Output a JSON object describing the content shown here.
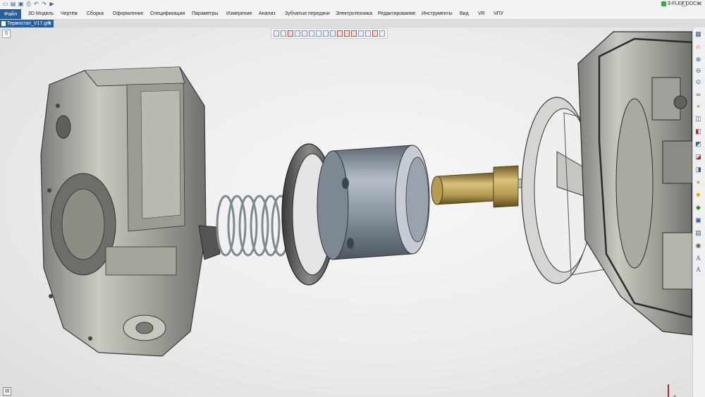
{
  "app": {
    "brand": "T-FLEX DOCs",
    "window_controls": [
      "–",
      "▢",
      "✕"
    ]
  },
  "menu": {
    "file": "Файл",
    "items": [
      "3D Модель",
      "Чертёж",
      "Сборка",
      "Оформление",
      "Спецификации",
      "Параметры",
      "Измерение",
      "Анализ",
      "Зубчатые передачи",
      "Электротехника",
      "Редактирование",
      "Инструменты",
      "Вид",
      "VR",
      "ЧПУ"
    ]
  },
  "tab": {
    "label": "Термостат_V17.grb"
  },
  "icons": {
    "quick_access": [
      "new-doc-icon",
      "open-icon",
      "save-icon",
      "print-icon",
      "undo-icon",
      "redo-icon",
      "run-icon"
    ],
    "right_panel": [
      "view-cube-icon",
      "magnet-icon",
      "zoom-in-icon",
      "zoom-out-icon",
      "zoom-fit-icon",
      "glasses-icon",
      "measure-icon",
      "section-icon",
      "color-icon",
      "material-icon",
      "light-icon",
      "text-icon"
    ]
  },
  "colors": {
    "accent": "#2a5f9e",
    "brand_green": "#3aa64a",
    "housing": "#a8aaa0",
    "brass": "#b59a52",
    "steel": "#8a95a3"
  }
}
